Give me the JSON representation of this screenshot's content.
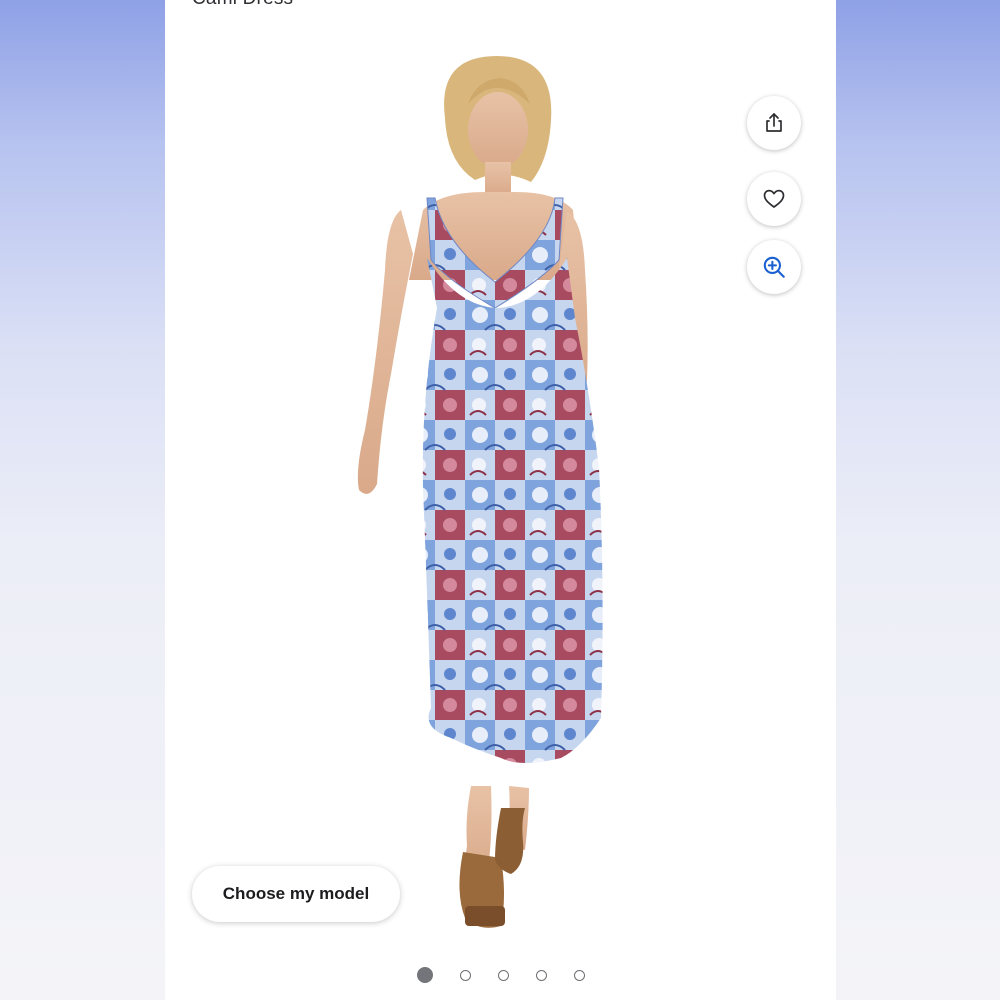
{
  "product": {
    "title": "Cami Dress"
  },
  "actions": {
    "share_icon": "share-icon",
    "favorite_icon": "heart-icon",
    "zoom_icon": "zoom-in-icon"
  },
  "model_button": {
    "label": "Choose my model"
  },
  "carousel": {
    "total": 5,
    "active_index": 0
  },
  "colors": {
    "accent_blue": "#1a5fd1",
    "dress_blue": "#7fa3dc",
    "dress_red": "#a84a60",
    "dress_light": "#d6e0f2"
  }
}
